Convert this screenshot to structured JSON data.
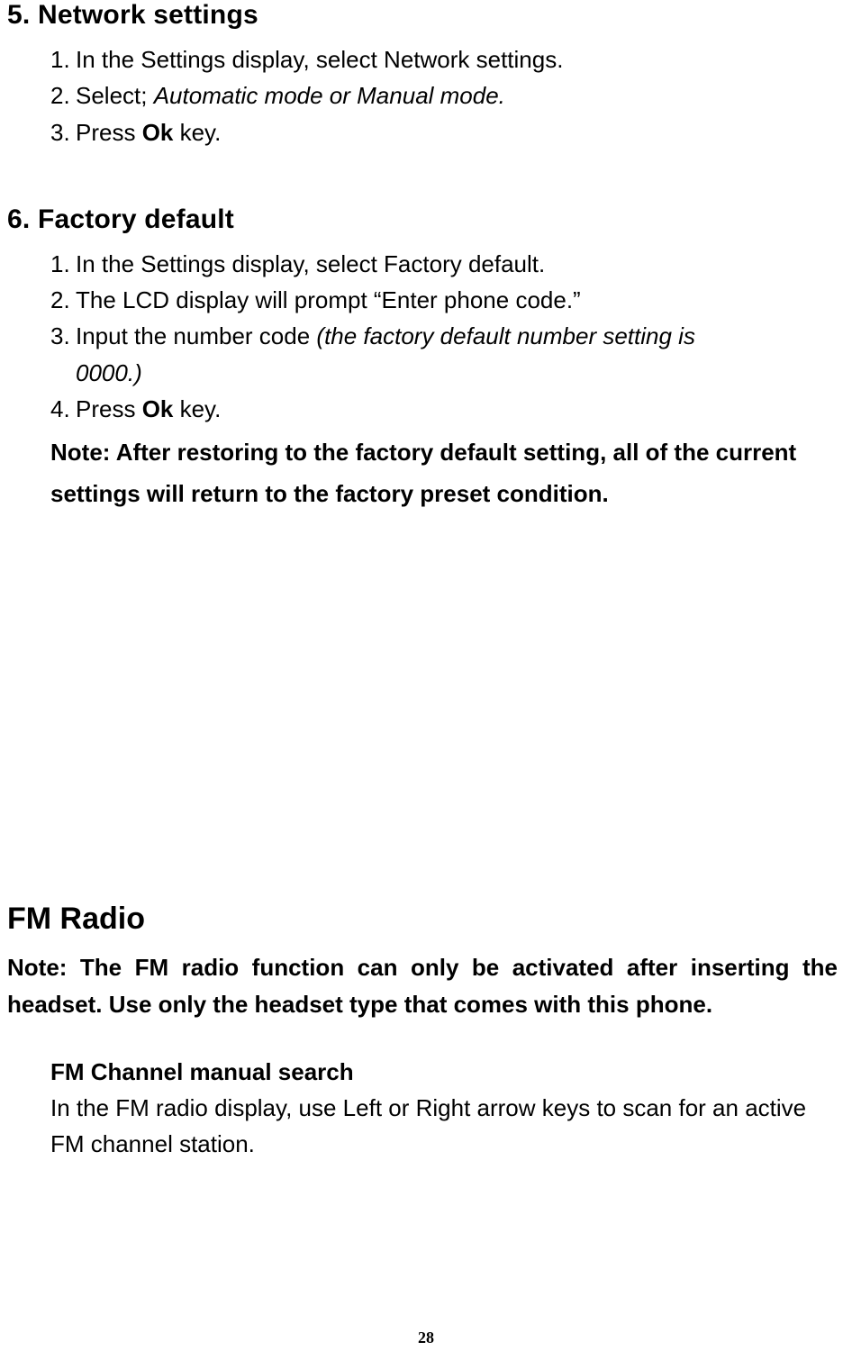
{
  "section5": {
    "heading": "5. Network settings",
    "items": [
      {
        "n": "1.",
        "text": "In the Settings display, select Network settings."
      },
      {
        "n": "2.",
        "pre": "Select; ",
        "italic": "Automatic mode or Manual mode."
      },
      {
        "n": "3.",
        "pre": "Press ",
        "bold": "Ok",
        "post": " key."
      }
    ]
  },
  "section6": {
    "heading": "6. Factory default",
    "items": [
      {
        "n": "1.",
        "text": "In the Settings display, select Factory default."
      },
      {
        "n": "2.",
        "text": "The LCD display will prompt “Enter phone code.”"
      },
      {
        "n": "3.",
        "pre": "Input the number code ",
        "italic": "(the factory default number setting is "
      },
      {
        "cont_italic": "0000.)"
      },
      {
        "n": "4.",
        "pre": "Press ",
        "bold": "Ok",
        "post": " key."
      }
    ],
    "note": "Note: After restoring to the factory default setting, all of the current settings will return to the factory preset condition."
  },
  "fm": {
    "heading": "FM Radio",
    "note": "Note: The FM radio function can only be activated after inserting the headset. Use only the headset type that comes with this phone.",
    "sub": {
      "heading": "FM Channel manual search",
      "body": "In the FM radio display, use Left or Right arrow keys to scan for an active FM channel station."
    }
  },
  "page_number": "28"
}
